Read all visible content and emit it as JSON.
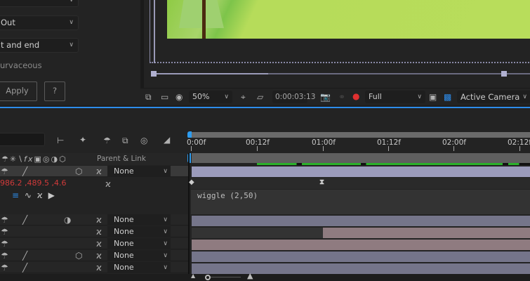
{
  "effects_panel": {
    "dropdowns": [
      "",
      "Out",
      "t and end"
    ],
    "checkbox_label": "urvaceous",
    "apply_label": "Apply",
    "help_label": "?"
  },
  "viewer_toolbar": {
    "zoom": "50%",
    "timecode": "0:00:03:13",
    "resolution": "Full",
    "camera": "Active Camera"
  },
  "timeline": {
    "ruler_ticks": [
      "0:00f",
      "00:12f",
      "01:00f",
      "01:12f",
      "02:00f",
      "02:12f"
    ],
    "parent_header": "Parent & Link",
    "position_value": "986.2 ,489.5 ,4.6",
    "expression": "wiggle (2,50)",
    "parent_values": [
      "None",
      "None",
      "None",
      "None",
      "None",
      "None"
    ]
  },
  "colors": {
    "accent": "#2d8ceb",
    "lavender": "#75758a",
    "rose": "#8f7b80",
    "work_area": "#2ab02a",
    "comp_green": "#b6dc5a"
  }
}
